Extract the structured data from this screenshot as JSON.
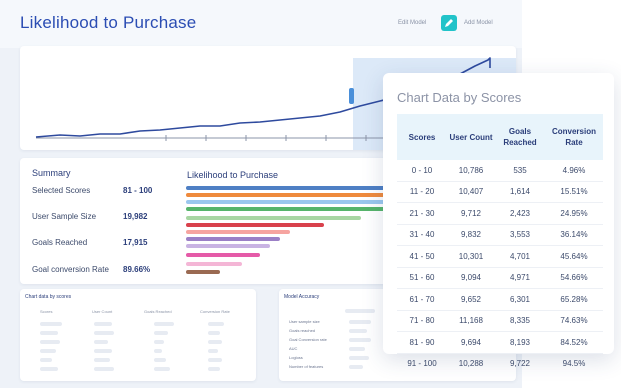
{
  "header": {
    "title": "Likelihood to Purchase",
    "edit_model": "Edit Model",
    "add_model": "Add Model"
  },
  "summary": {
    "title": "Summary",
    "rows": [
      {
        "label": "Selected Scores",
        "value": "81 - 100"
      },
      {
        "label": "User Sample Size",
        "value": "19,982"
      },
      {
        "label": "Goals Reached",
        "value": "17,915"
      },
      {
        "label": "Goal conversion Rate",
        "value": "89.66%"
      }
    ],
    "chart_title": "Likelihood to Purchase"
  },
  "bar_colors": [
    "#4e7fc4",
    "#ef8a3c",
    "#9bc7ee",
    "#56b46b",
    "#a8d6a3",
    "#d9414c",
    "#f6a4a0",
    "#9b7fc6",
    "#c9b3e3",
    "#e55aa8",
    "#f4b6d6",
    "#9a6a52"
  ],
  "bottom_left": {
    "title": "Chart data by scores",
    "headers": [
      "Scores",
      "User Count",
      "Goals Reached",
      "Conversion Rate"
    ]
  },
  "bottom_right": {
    "title": "Model Accuracy",
    "labels": [
      "User sample size",
      "Goals reached",
      "Goal Conversion rate",
      "AUC",
      "Logloss",
      "Number of features"
    ]
  },
  "panel": {
    "title": "Chart Data by Scores",
    "headers": [
      "Scores",
      "User Count",
      "Goals Reached",
      "Conversion Rate"
    ],
    "rows": [
      [
        "0 - 10",
        "10,786",
        "535",
        "4.96%"
      ],
      [
        "11 - 20",
        "10,407",
        "1,614",
        "15.51%"
      ],
      [
        "21 - 30",
        "9,712",
        "2,423",
        "24.95%"
      ],
      [
        "31 - 40",
        "9,832",
        "3,553",
        "36.14%"
      ],
      [
        "41 - 50",
        "10,301",
        "4,701",
        "45.64%"
      ],
      [
        "51 - 60",
        "9,094",
        "4,971",
        "54.66%"
      ],
      [
        "61 - 70",
        "9,652",
        "6,301",
        "65.28%"
      ],
      [
        "71 - 80",
        "11,168",
        "8,335",
        "74.63%"
      ],
      [
        "81 - 90",
        "9,694",
        "8,193",
        "84.52%"
      ],
      [
        "91 - 100",
        "10,288",
        "9,722",
        "94.5%"
      ]
    ]
  }
}
